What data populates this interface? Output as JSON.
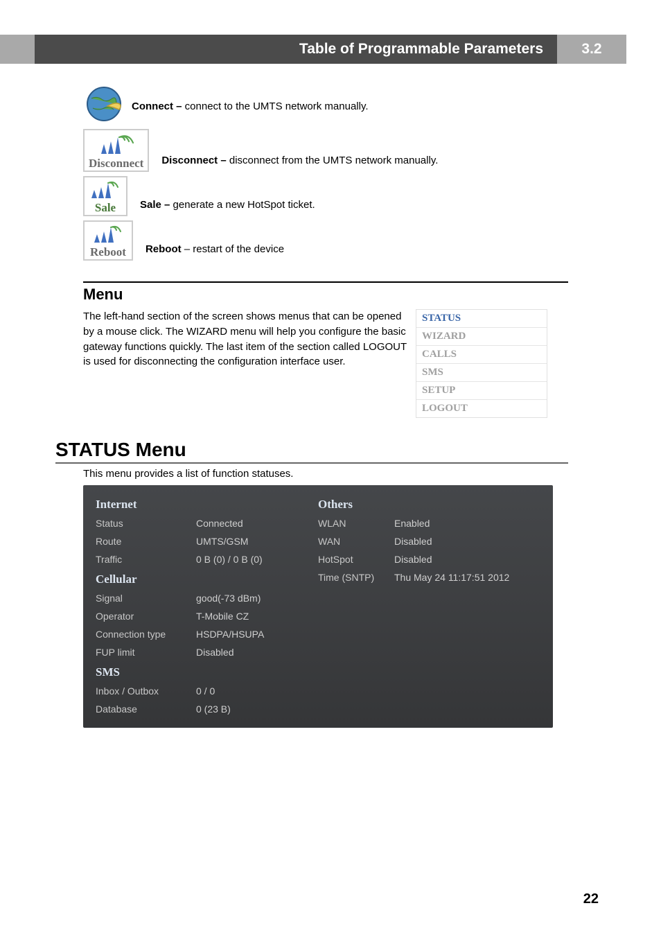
{
  "header": {
    "title": "Table of Programmable Parameters",
    "section_number": "3.2"
  },
  "actions": {
    "connect": {
      "label": "Connect –",
      "desc": " connect to the UMTS network manually."
    },
    "disconnect": {
      "caption": "Disconnect",
      "label": "Disconnect –",
      "desc": " disconnect from the UMTS network manually."
    },
    "sale": {
      "caption": "Sale",
      "label": "Sale –",
      "desc": " generate a new HotSpot ticket."
    },
    "reboot": {
      "caption": "Reboot",
      "label": "Reboot",
      "desc": " – restart of the device"
    }
  },
  "menu": {
    "heading": "Menu",
    "body": " The left-hand section of the screen shows menus that can be opened by a mouse click. The WIZARD menu will help you configure the basic gateway functions quickly. The last item of the section called LOGOUT is used for disconnecting the configuration interface user.",
    "items": [
      "STATUS",
      "WIZARD",
      "CALLS",
      "SMS",
      "SETUP",
      "LOGOUT"
    ]
  },
  "status_menu": {
    "heading": "STATUS Menu",
    "intro": "This menu provides a list of function statuses.",
    "left": {
      "cat1": "Internet",
      "rows1": [
        {
          "label": "Status",
          "value": "Connected"
        },
        {
          "label": "Route",
          "value": "UMTS/GSM"
        },
        {
          "label": "Traffic",
          "value": "0 B (0) / 0 B (0)"
        }
      ],
      "cat2": "Cellular",
      "rows2": [
        {
          "label": "Signal",
          "value": "good(-73 dBm)"
        },
        {
          "label": "Operator",
          "value": "T-Mobile CZ"
        },
        {
          "label": "Connection type",
          "value": "HSDPA/HSUPA"
        },
        {
          "label": "FUP limit",
          "value": "Disabled"
        }
      ],
      "cat3": "SMS",
      "rows3": [
        {
          "label": "Inbox / Outbox",
          "value": "0 / 0"
        },
        {
          "label": "Database",
          "value": "0 (23 B)"
        }
      ]
    },
    "right": {
      "cat1": "Others",
      "rows1": [
        {
          "label": "WLAN",
          "value": "Enabled"
        },
        {
          "label": "WAN",
          "value": "Disabled"
        },
        {
          "label": "HotSpot",
          "value": "Disabled"
        },
        {
          "label": "Time (SNTP)",
          "value": "Thu May 24 11:17:51 2012"
        }
      ]
    }
  },
  "page_number": "22"
}
